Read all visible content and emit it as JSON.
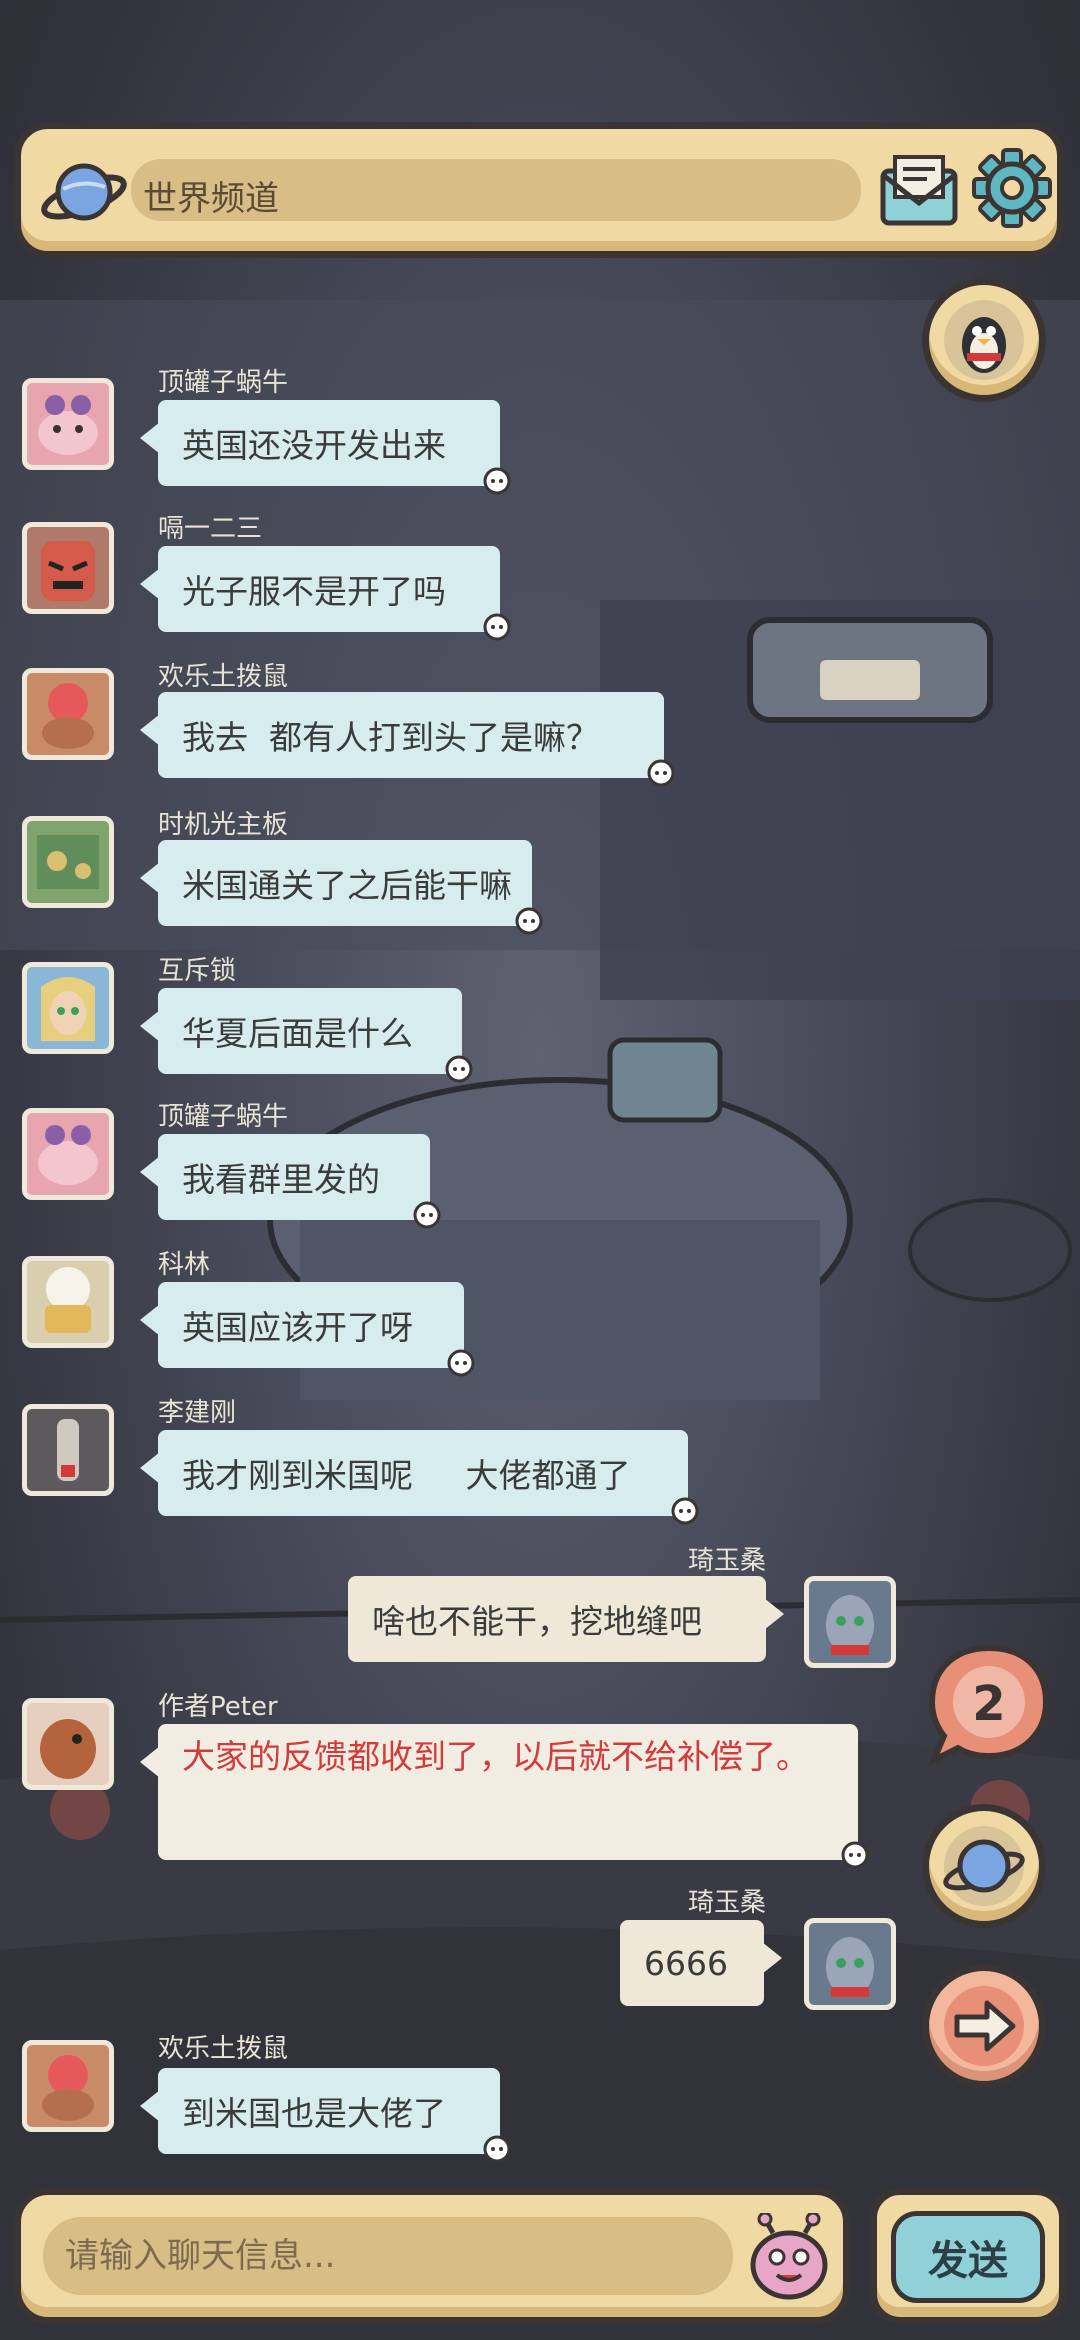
{
  "header": {
    "channel_label": "世界频道",
    "icons": {
      "channel": "planet-icon",
      "mail": "mail-icon",
      "settings": "gear-icon"
    }
  },
  "side_buttons": {
    "qq": "penguin-icon",
    "unread_count": "2",
    "world": "planet-icon",
    "next": "arrow-right-icon"
  },
  "messages": [
    {
      "sender": "顶罐子蜗牛",
      "text": "英国还没开发出来"
    },
    {
      "sender": "嗝一二三",
      "text": "光子服不是开了吗"
    },
    {
      "sender": "欢乐土拨鼠",
      "text": "我去  都有人打到头了是嘛？"
    },
    {
      "sender": "时机光主板",
      "text": "米国通关了之后能干嘛"
    },
    {
      "sender": "互斥锁",
      "text": "华夏后面是什么"
    },
    {
      "sender": "顶罐子蜗牛",
      "text": "我看群里发的"
    },
    {
      "sender": "科林",
      "text": "英国应该开了呀"
    },
    {
      "sender": "李建刚",
      "text": "我才刚到米国呢     大佬都通了"
    },
    {
      "sender": "琦玉桑",
      "text": "啥也不能干，挖地缝吧"
    },
    {
      "sender": "作者Peter",
      "text": "大家的反馈都收到了，以后就不给补偿了。"
    },
    {
      "sender": "琦玉桑",
      "text": "6666"
    },
    {
      "sender": "欢乐土拨鼠",
      "text": "到米国也是大佬了"
    }
  ],
  "input": {
    "placeholder": "请输入聊天信息...",
    "emoji_icon": "alien-emoji-icon",
    "send_label": "发送"
  },
  "colors": {
    "panel": "#f0d9a3",
    "outline": "#3a3534",
    "bubble_other": "#d6ecee",
    "bubble_mine": "#efe8d8",
    "author_text": "#d43a3a",
    "send_button": "#8fd1d6"
  }
}
